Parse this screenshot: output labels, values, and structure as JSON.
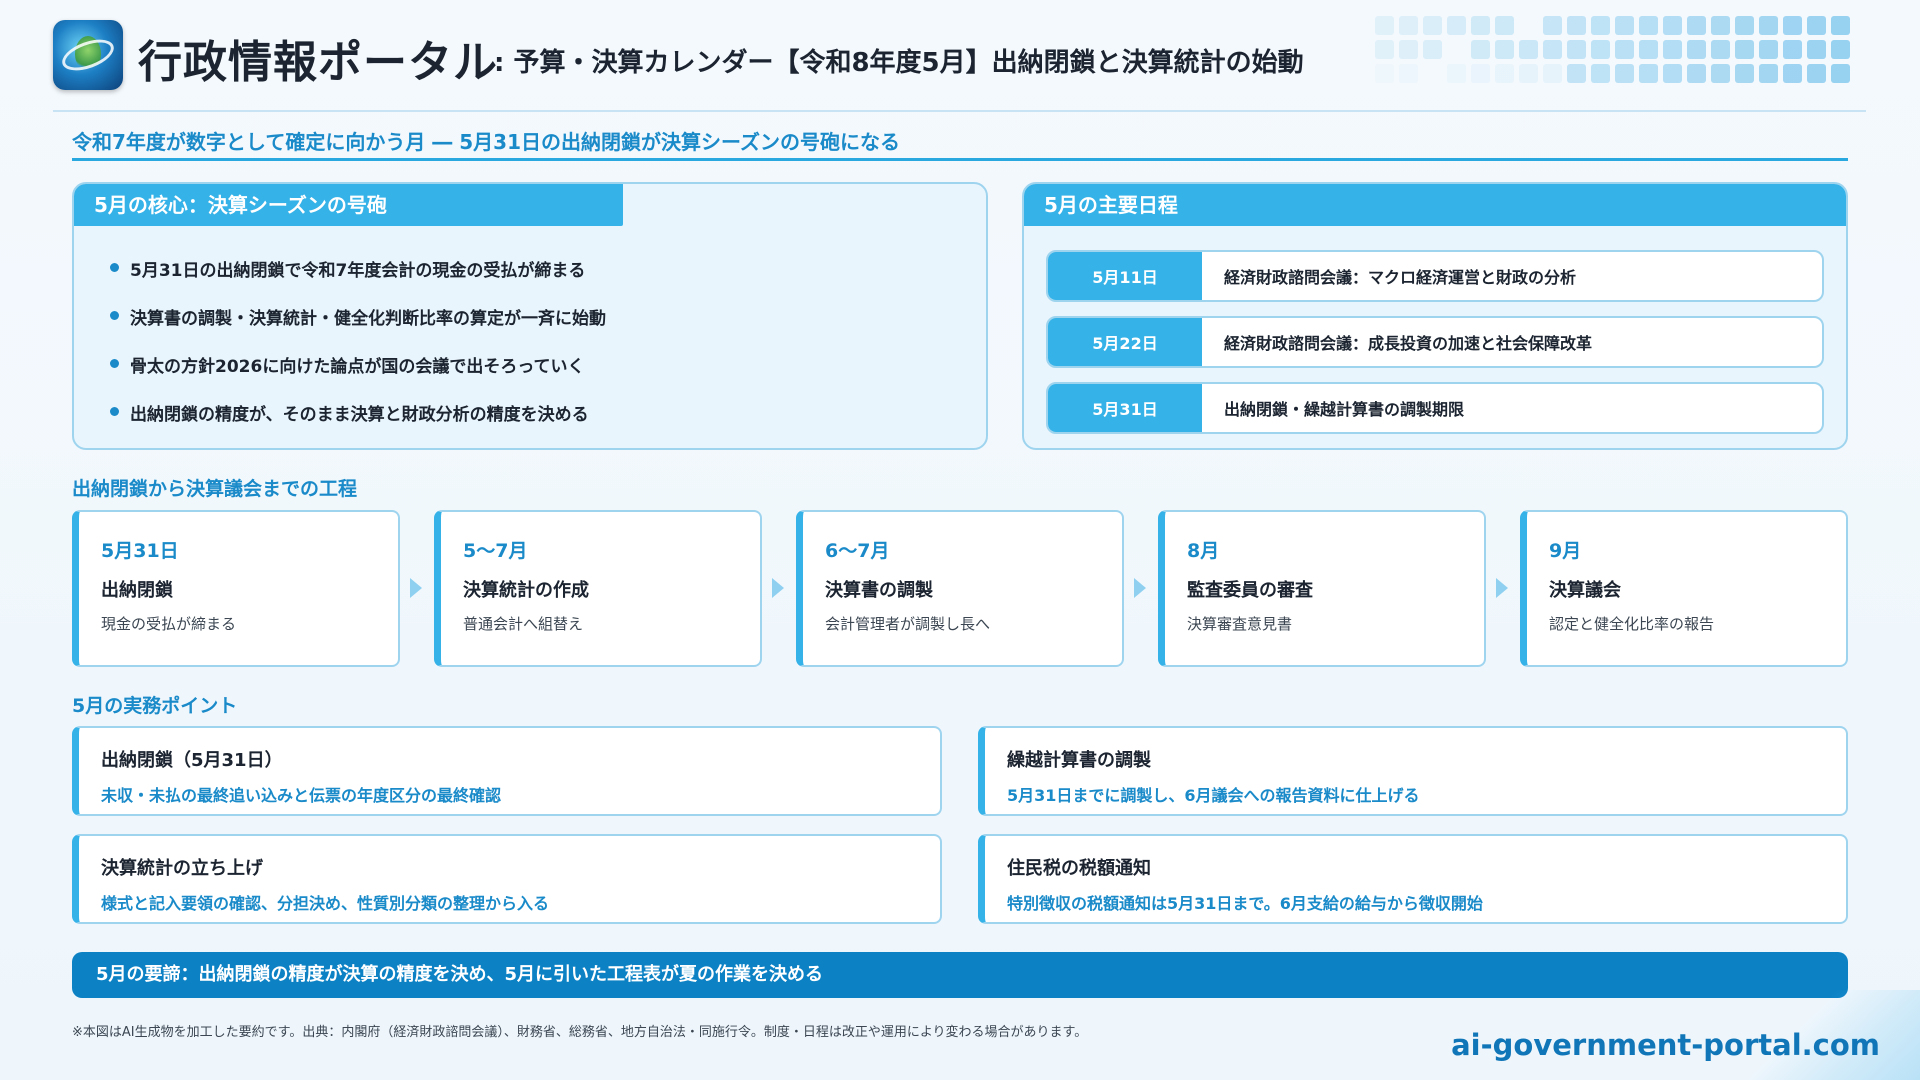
{
  "header": {
    "brand": "行政情報ポータル",
    "subtitle": ": 予算・決算カレンダー【令和8年度5月】出納閉鎖と決算統計の始動"
  },
  "lead": "令和7年度が数字として確定に向かう月 ― 5月31日の出納閉鎖が決算シーズンの号砲になる",
  "core": {
    "title": "5月の核心：決算シーズンの号砲",
    "bullets": [
      "5月31日の出納閉鎖で令和7年度会計の現金の受払が締まる",
      "決算書の調製・決算統計・健全化判断比率の算定が一斉に始動",
      "骨太の方針2026に向けた論点が国の会議で出そろっていく",
      "出納閉鎖の精度が、そのまま決算と財政分析の精度を決める"
    ]
  },
  "schedule": {
    "title": "5月の主要日程",
    "items": [
      {
        "date": "5月11日",
        "text": "経済財政諮問会議：マクロ経済運営と財政の分析"
      },
      {
        "date": "5月22日",
        "text": "経済財政諮問会議：成長投資の加速と社会保障改革"
      },
      {
        "date": "5月31日",
        "text": "出納閉鎖・繰越計算書の調製期限"
      }
    ]
  },
  "flow": {
    "title": "出納閉鎖から決算議会までの工程",
    "steps": [
      {
        "month": "5月31日",
        "name": "出納閉鎖",
        "desc": "現金の受払が締まる"
      },
      {
        "month": "5〜7月",
        "name": "決算統計の作成",
        "desc": "普通会計へ組替え"
      },
      {
        "month": "6〜7月",
        "name": "決算書の調製",
        "desc": "会計管理者が調製し長へ"
      },
      {
        "month": "8月",
        "name": "監査委員の審査",
        "desc": "決算審査意見書"
      },
      {
        "month": "9月",
        "name": "決算議会",
        "desc": "認定と健全化比率の報告"
      }
    ]
  },
  "points": {
    "title": "5月の実務ポイント",
    "items": [
      {
        "title": "出納閉鎖（5月31日）",
        "desc": "未収・未払の最終追い込みと伝票の年度区分の最終確認"
      },
      {
        "title": "繰越計算書の調製",
        "desc": "5月31日までに調製し、6月議会への報告資料に仕上げる"
      },
      {
        "title": "決算統計の立ち上げ",
        "desc": "様式と記入要領の確認、分担決め、性質別分類の整理から入る"
      },
      {
        "title": "住民税の税額通知",
        "desc": "特別徴収の税額通知は5月31日まで。6月支給の給与から徴収開始"
      }
    ]
  },
  "summary": "5月の要諦：出納閉鎖の精度が決算の精度を決め、5月に引いた工程表が夏の作業を決める",
  "footnote": "※本図はAI生成物を加工した要約です。出典：内閣府（経済財政諮問会議）、財務省、総務省、地方自治法・同施行令。制度・日程は改正や運用により変わる場合があります。",
  "url": "ai-government-portal.com",
  "colors": {
    "accent": "#35b2e8",
    "accent_dark": "#0c82c5",
    "text_blue": "#1a8ac9",
    "panel_bg": "#e9f5fc",
    "border": "#9fd4ef"
  },
  "icons": {
    "logo": "globe-logo-icon",
    "step_arrow": "triangle-right-icon",
    "bullet": "dot-icon"
  }
}
